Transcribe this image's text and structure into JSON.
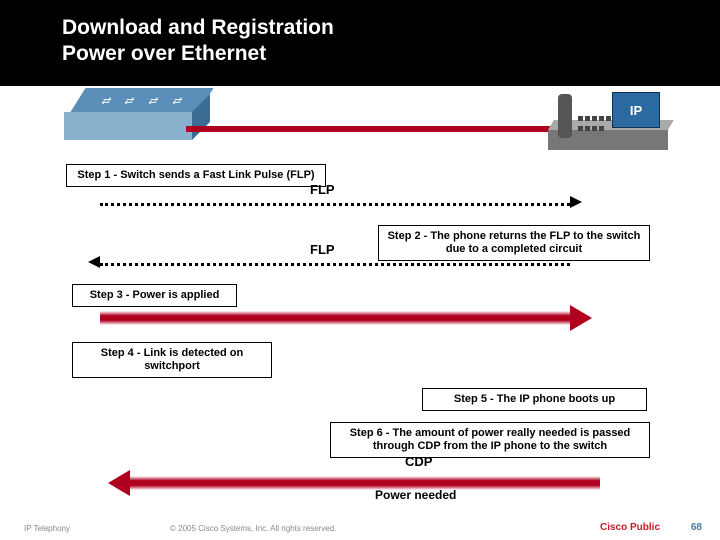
{
  "header": {
    "line1": "Download and Registration",
    "line2": "Power over Ethernet"
  },
  "devices": {
    "switch_name": "network-switch",
    "phone_name": "ip-phone",
    "phone_label": "IP"
  },
  "steps": {
    "s1": "Step 1 - Switch sends a Fast Link Pulse (FLP)",
    "s2": "Step 2 - The phone returns the FLP to the switch due to a completed circuit",
    "s3": "Step 3 - Power is applied",
    "s4": "Step 4 - Link is detected on switchport",
    "s5": "Step 5 - The IP phone boots up",
    "s6": "Step 6 - The amount of power really needed is passed through CDP from the IP phone to the switch"
  },
  "labels": {
    "flp1": "FLP",
    "flp2": "FLP",
    "cdp": "CDP",
    "power_needed": "Power needed"
  },
  "footer": {
    "left": "IP Telephony",
    "center": "© 2005 Cisco Systems, Inc. All rights reserved.",
    "brand": "Cisco Public",
    "page": "68"
  }
}
